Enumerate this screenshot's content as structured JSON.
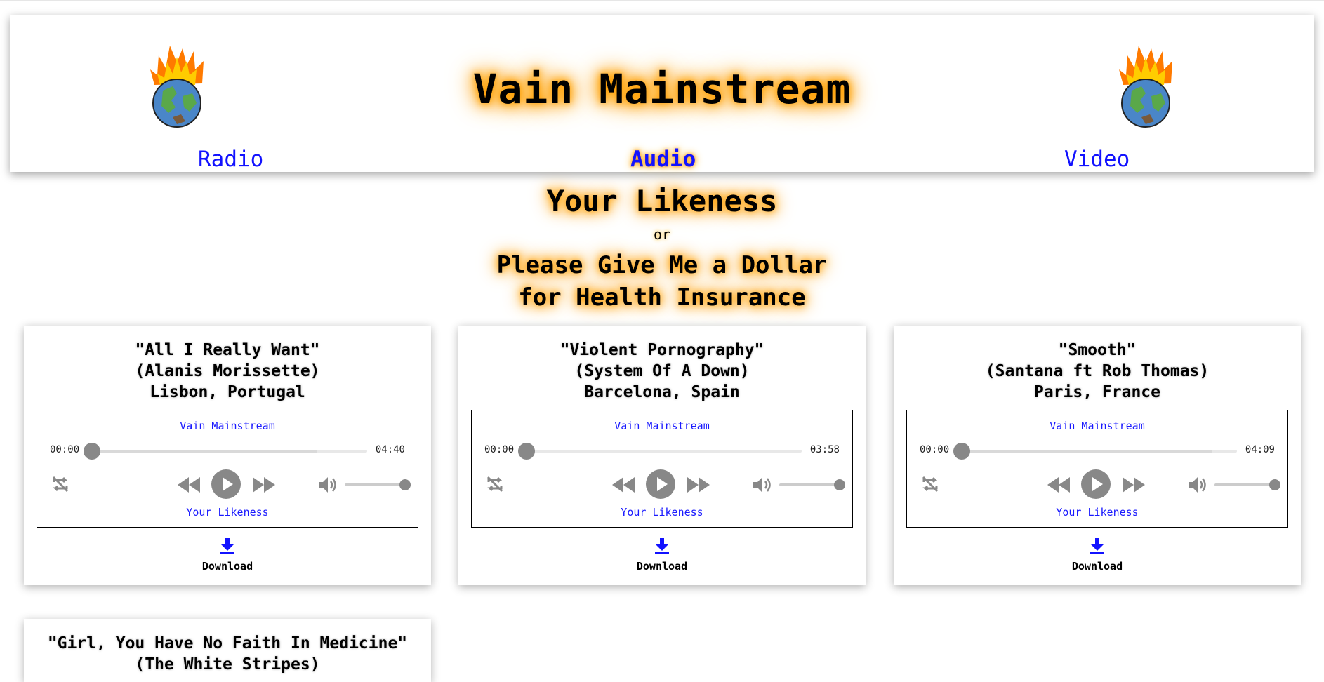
{
  "header": {
    "site_title": "Vain Mainstream",
    "nav": [
      {
        "label": "Radio",
        "active": false
      },
      {
        "label": "Audio",
        "active": true
      },
      {
        "label": "Video",
        "active": false
      }
    ]
  },
  "hero": {
    "album_title": "Your Likeness",
    "or_text": "or",
    "subtitle_line1": "Please Give Me a Dollar",
    "subtitle_line2": "for Health Insurance"
  },
  "tracks": [
    {
      "song": "\"All I Really Want\"",
      "artist": "(Alanis Morissette)",
      "location": "Lisbon, Portugal",
      "player_artist": "Vain Mainstream",
      "player_album": "Your Likeness",
      "current_time": "00:00",
      "duration": "04:40",
      "progress": 0,
      "volume": 1,
      "download_label": "Download"
    },
    {
      "song": "\"Violent Pornography\"",
      "artist": "(System Of A Down)",
      "location": "Barcelona, Spain",
      "player_artist": "Vain Mainstream",
      "player_album": "Your Likeness",
      "current_time": "00:00",
      "duration": "03:58",
      "progress": 0,
      "volume": 1,
      "download_label": "Download"
    },
    {
      "song": "\"Smooth\"",
      "artist": "(Santana ft Rob Thomas)",
      "location": "Paris, France",
      "player_artist": "Vain Mainstream",
      "player_album": "Your Likeness",
      "current_time": "00:00",
      "duration": "04:09",
      "progress": 0,
      "volume": 1,
      "download_label": "Download"
    },
    {
      "song": "\"Girl, You Have No Faith In Medicine\"",
      "artist": "(The White Stripes)"
    }
  ],
  "colors": {
    "link": "#1212ff",
    "glow": "#ff9a00",
    "control_gray": "#888888"
  },
  "icons": [
    "flaming-earth-icon",
    "loop-icon",
    "rewind-icon",
    "play-icon",
    "fast-forward-icon",
    "volume-icon",
    "download-icon"
  ]
}
